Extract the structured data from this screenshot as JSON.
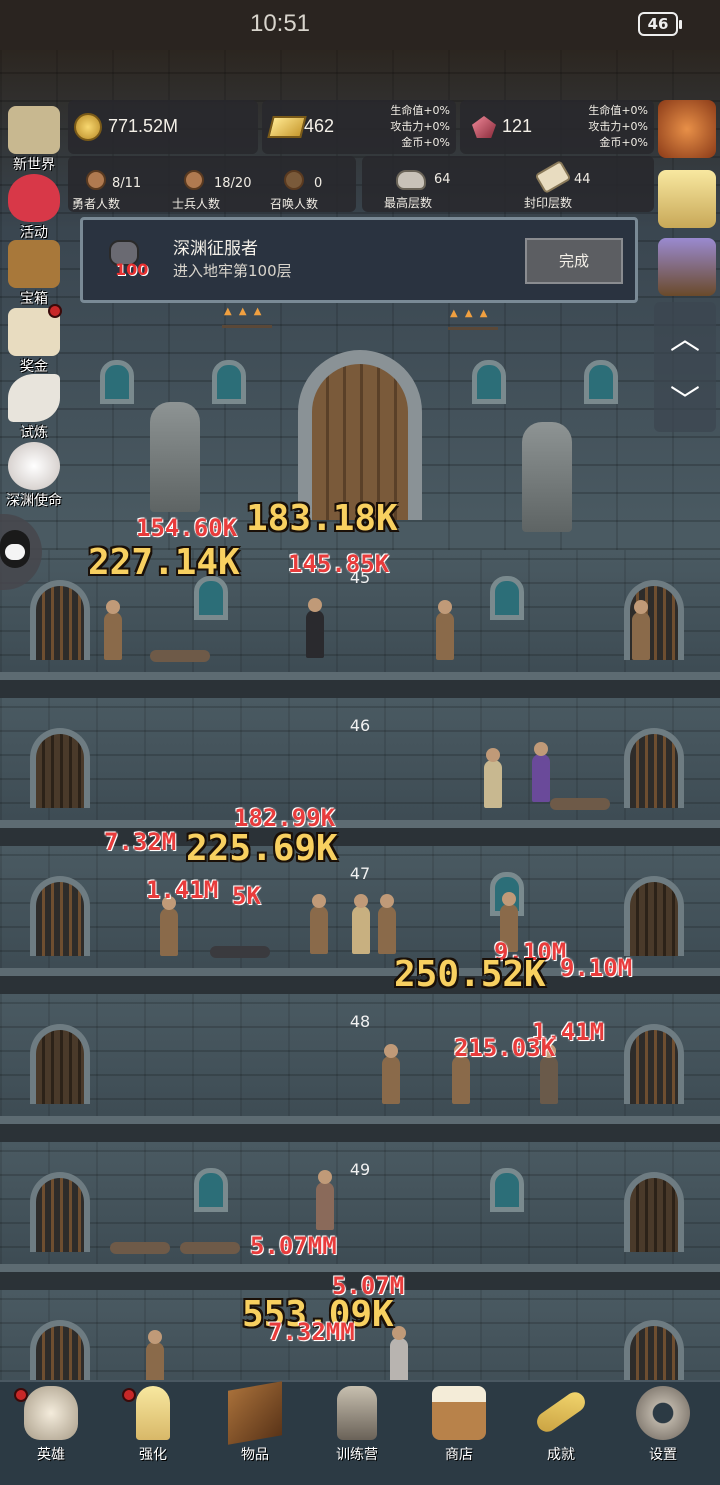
{
  "status_bar": {
    "time": "10:51",
    "battery": "46"
  },
  "resources": {
    "gold": {
      "value": "771.52M"
    },
    "goldbar": {
      "value": "462",
      "bonus": [
        "生命值+0%",
        "攻击力+0%",
        "金币+0%"
      ]
    },
    "gem": {
      "value": "121",
      "bonus": [
        "生命值+0%",
        "攻击力+0%",
        "金币+0%"
      ]
    }
  },
  "stats": [
    {
      "value": "8/11",
      "label": "勇者人数",
      "icon": "hero-head-icon"
    },
    {
      "value": "18/20",
      "label": "士兵人数",
      "icon": "soldier-head-icon"
    },
    {
      "value": "0",
      "label": "召唤人数",
      "icon": "summon-head-icon"
    },
    {
      "value": "64",
      "label": "最高层数",
      "icon": "rock-icon"
    },
    {
      "value": "44",
      "label": "封印层数",
      "icon": "scroll-icon"
    }
  ],
  "achievement": {
    "title": "深渊征服者",
    "description": "进入地牢第100层",
    "badge": "100",
    "button": "完成"
  },
  "left_menu": [
    {
      "label": "新世界",
      "icon": "map-icon",
      "color": "#c8b890",
      "dot": false
    },
    {
      "label": "活动",
      "icon": "heart-icon",
      "color": "#d83848",
      "dot": false
    },
    {
      "label": "宝箱",
      "icon": "chest-icon",
      "color": "#a8783a",
      "dot": false
    },
    {
      "label": "奖金",
      "icon": "envelope-icon",
      "color": "#e8dcc0",
      "dot": true
    },
    {
      "label": "试炼",
      "icon": "feather-icon",
      "color": "#e8e4dc",
      "dot": false
    },
    {
      "label": "深渊使命",
      "icon": "pearl-icon",
      "color": "#e4dcd8",
      "dot": false
    }
  ],
  "right_menu": [
    {
      "icon": "apple-icon",
      "color": "#d87a3a"
    },
    {
      "icon": "candle-icon",
      "color": "#f0d890"
    },
    {
      "icon": "treasure-chest-icon",
      "color": "#7a6ab0"
    }
  ],
  "floors": [
    "45",
    "46",
    "47",
    "48",
    "49"
  ],
  "damage_numbers": [
    {
      "text": "154.60K",
      "style": "red"
    },
    {
      "text": "183.18K",
      "style": "gold"
    },
    {
      "text": "227.14K",
      "style": "gold"
    },
    {
      "text": "145.85K",
      "style": "red"
    },
    {
      "text": "182.99K",
      "style": "red"
    },
    {
      "text": "7.32M",
      "style": "red"
    },
    {
      "text": "225.69K",
      "style": "gold"
    },
    {
      "text": "1.41M",
      "style": "red"
    },
    {
      "text": "5K",
      "style": "red"
    },
    {
      "text": "9.10M",
      "style": "red"
    },
    {
      "text": "9.10M",
      "style": "red"
    },
    {
      "text": "250.52K",
      "style": "gold"
    },
    {
      "text": "1.41M",
      "style": "red"
    },
    {
      "text": "215.03K",
      "style": "red"
    },
    {
      "text": "5.07MM",
      "style": "red"
    },
    {
      "text": "5.07M",
      "style": "red"
    },
    {
      "text": "553.09K",
      "style": "gold"
    },
    {
      "text": "7.32MM",
      "style": "red"
    }
  ],
  "bottom_nav": [
    {
      "label": "英雄",
      "icon": "skull-icon",
      "color": "#e8e0d0",
      "dot": true
    },
    {
      "label": "强化",
      "icon": "candle-icon",
      "color": "#f0d890",
      "dot": true
    },
    {
      "label": "物品",
      "icon": "book-icon",
      "color": "#8a5a2a",
      "dot": false
    },
    {
      "label": "训练营",
      "icon": "lantern-icon",
      "color": "#b8b0a0",
      "dot": false
    },
    {
      "label": "商店",
      "icon": "mug-icon",
      "color": "#c89a5a",
      "dot": false
    },
    {
      "label": "成就",
      "icon": "key-icon",
      "color": "#e8c060",
      "dot": false
    },
    {
      "label": "设置",
      "icon": "gear-icon",
      "color": "#a8a098",
      "dot": false
    }
  ]
}
